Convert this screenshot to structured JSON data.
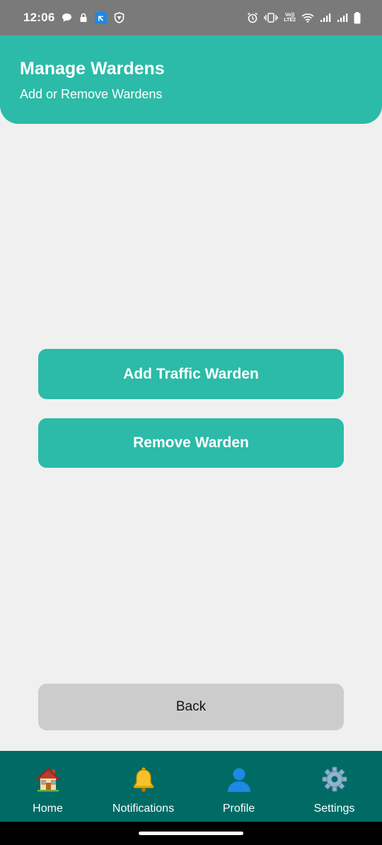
{
  "status_bar": {
    "time": "12:06",
    "volte_line1": "Vo))",
    "volte_line2": "LTE2",
    "icons_left": [
      "chat-bubble-icon",
      "lock-icon",
      "app-notification-icon",
      "vpn-shield-icon"
    ],
    "icons_right": [
      "alarm-icon",
      "vibrate-icon",
      "volte-icon",
      "wifi-icon",
      "signal-1-icon",
      "signal-2-icon",
      "battery-icon"
    ]
  },
  "header": {
    "title": "Manage Wardens",
    "subtitle": "Add or Remove Wardens"
  },
  "actions": {
    "add_label": "Add Traffic Warden",
    "remove_label": "Remove Warden",
    "back_label": "Back"
  },
  "bottom_nav": {
    "items": [
      {
        "label": "Home",
        "icon": "house-icon"
      },
      {
        "label": "Notifications",
        "icon": "bell-icon"
      },
      {
        "label": "Profile",
        "icon": "person-icon"
      },
      {
        "label": "Settings",
        "icon": "gear-icon"
      }
    ]
  },
  "colors": {
    "primary": "#2bbba8",
    "nav_background": "#006b65",
    "back_button": "#cccccc",
    "page_background": "#f0f0f0",
    "status_bar": "#7a7a7a"
  }
}
